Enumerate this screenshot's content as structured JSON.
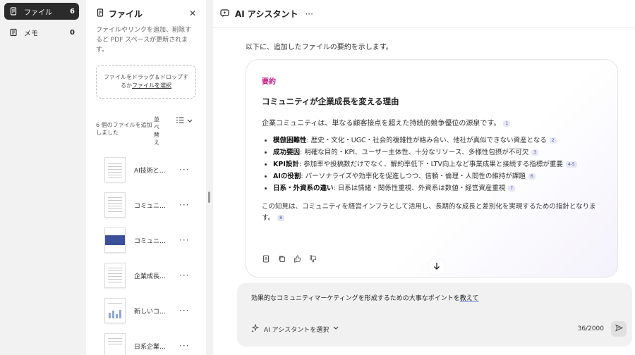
{
  "nav": {
    "items": [
      {
        "label": "ファイル",
        "count": "6"
      },
      {
        "label": "メモ",
        "count": "0"
      }
    ]
  },
  "files_panel": {
    "title": "ファイル",
    "description": "ファイルやリンクを追加、削除すると PDF スペースが更新されます。",
    "dropzone_text": "ファイルをドラッグ＆ドロップするか",
    "dropzone_link": "ファイルを選択",
    "count_text": "6 個のファイルを追加しました",
    "sort_label": "並べ替え",
    "files": [
      {
        "name": "AI技術と…",
        "thumb": "doc"
      },
      {
        "name": "コミュニ…",
        "thumb": "doc"
      },
      {
        "name": "コミュニ…",
        "thumb": "blue"
      },
      {
        "name": "企業成長…",
        "thumb": "doc"
      },
      {
        "name": "新しいコ…",
        "thumb": "chart"
      },
      {
        "name": "日系企業…",
        "thumb": "doc"
      }
    ]
  },
  "assistant": {
    "title": "AI アシスタント",
    "intro": "以下に、追加したファイルの要約を示します。",
    "summary": {
      "tag": "要約",
      "heading": "コミュニティが企業成長を変える理由",
      "lead": "企業コミュニティは、単なる顧客接点を超えた持続的競争優位の源泉です。",
      "lead_cite": "1",
      "bullets": [
        {
          "term": "模倣困難性",
          "text": ": 歴史・文化・UGC・社会的複雑性が絡み合い、他社が真似できない資産となる",
          "cite": "2"
        },
        {
          "term": "成功要因",
          "text": ": 明確な目的・KPI、ユーザー主体性、十分なリソース、多様性包摂が不可欠",
          "cite": "3"
        },
        {
          "term": "KPI設計",
          "text": ": 参加率や投稿数だけでなく、解約率低下・LTV向上など事業成果と接続する指標が重要",
          "cite": "4-5"
        },
        {
          "term": "AIの役割",
          "text": ": パーソナライズや効率化を促進しつつ、信頼・倫理・人間性の維持が課題",
          "cite": "6"
        },
        {
          "term": "日系・外資系の違い",
          "text": ": 日系は情緒・関係性重視、外資系は数値・経営資産重視",
          "cite": "7"
        }
      ],
      "conclusion": "この知見は、コミュニティを経営インフラとして活用し、長期的な成長と差別化を実現するための指針となります。",
      "conclusion_cite": "8"
    },
    "composer": {
      "query_prefix": "効果的なコミュニティマーケティングを形成するための大事なポイントを",
      "query_underlined": "教えて",
      "model_select": "AI アシスタントを選択",
      "char_count": "36/2000"
    }
  }
}
